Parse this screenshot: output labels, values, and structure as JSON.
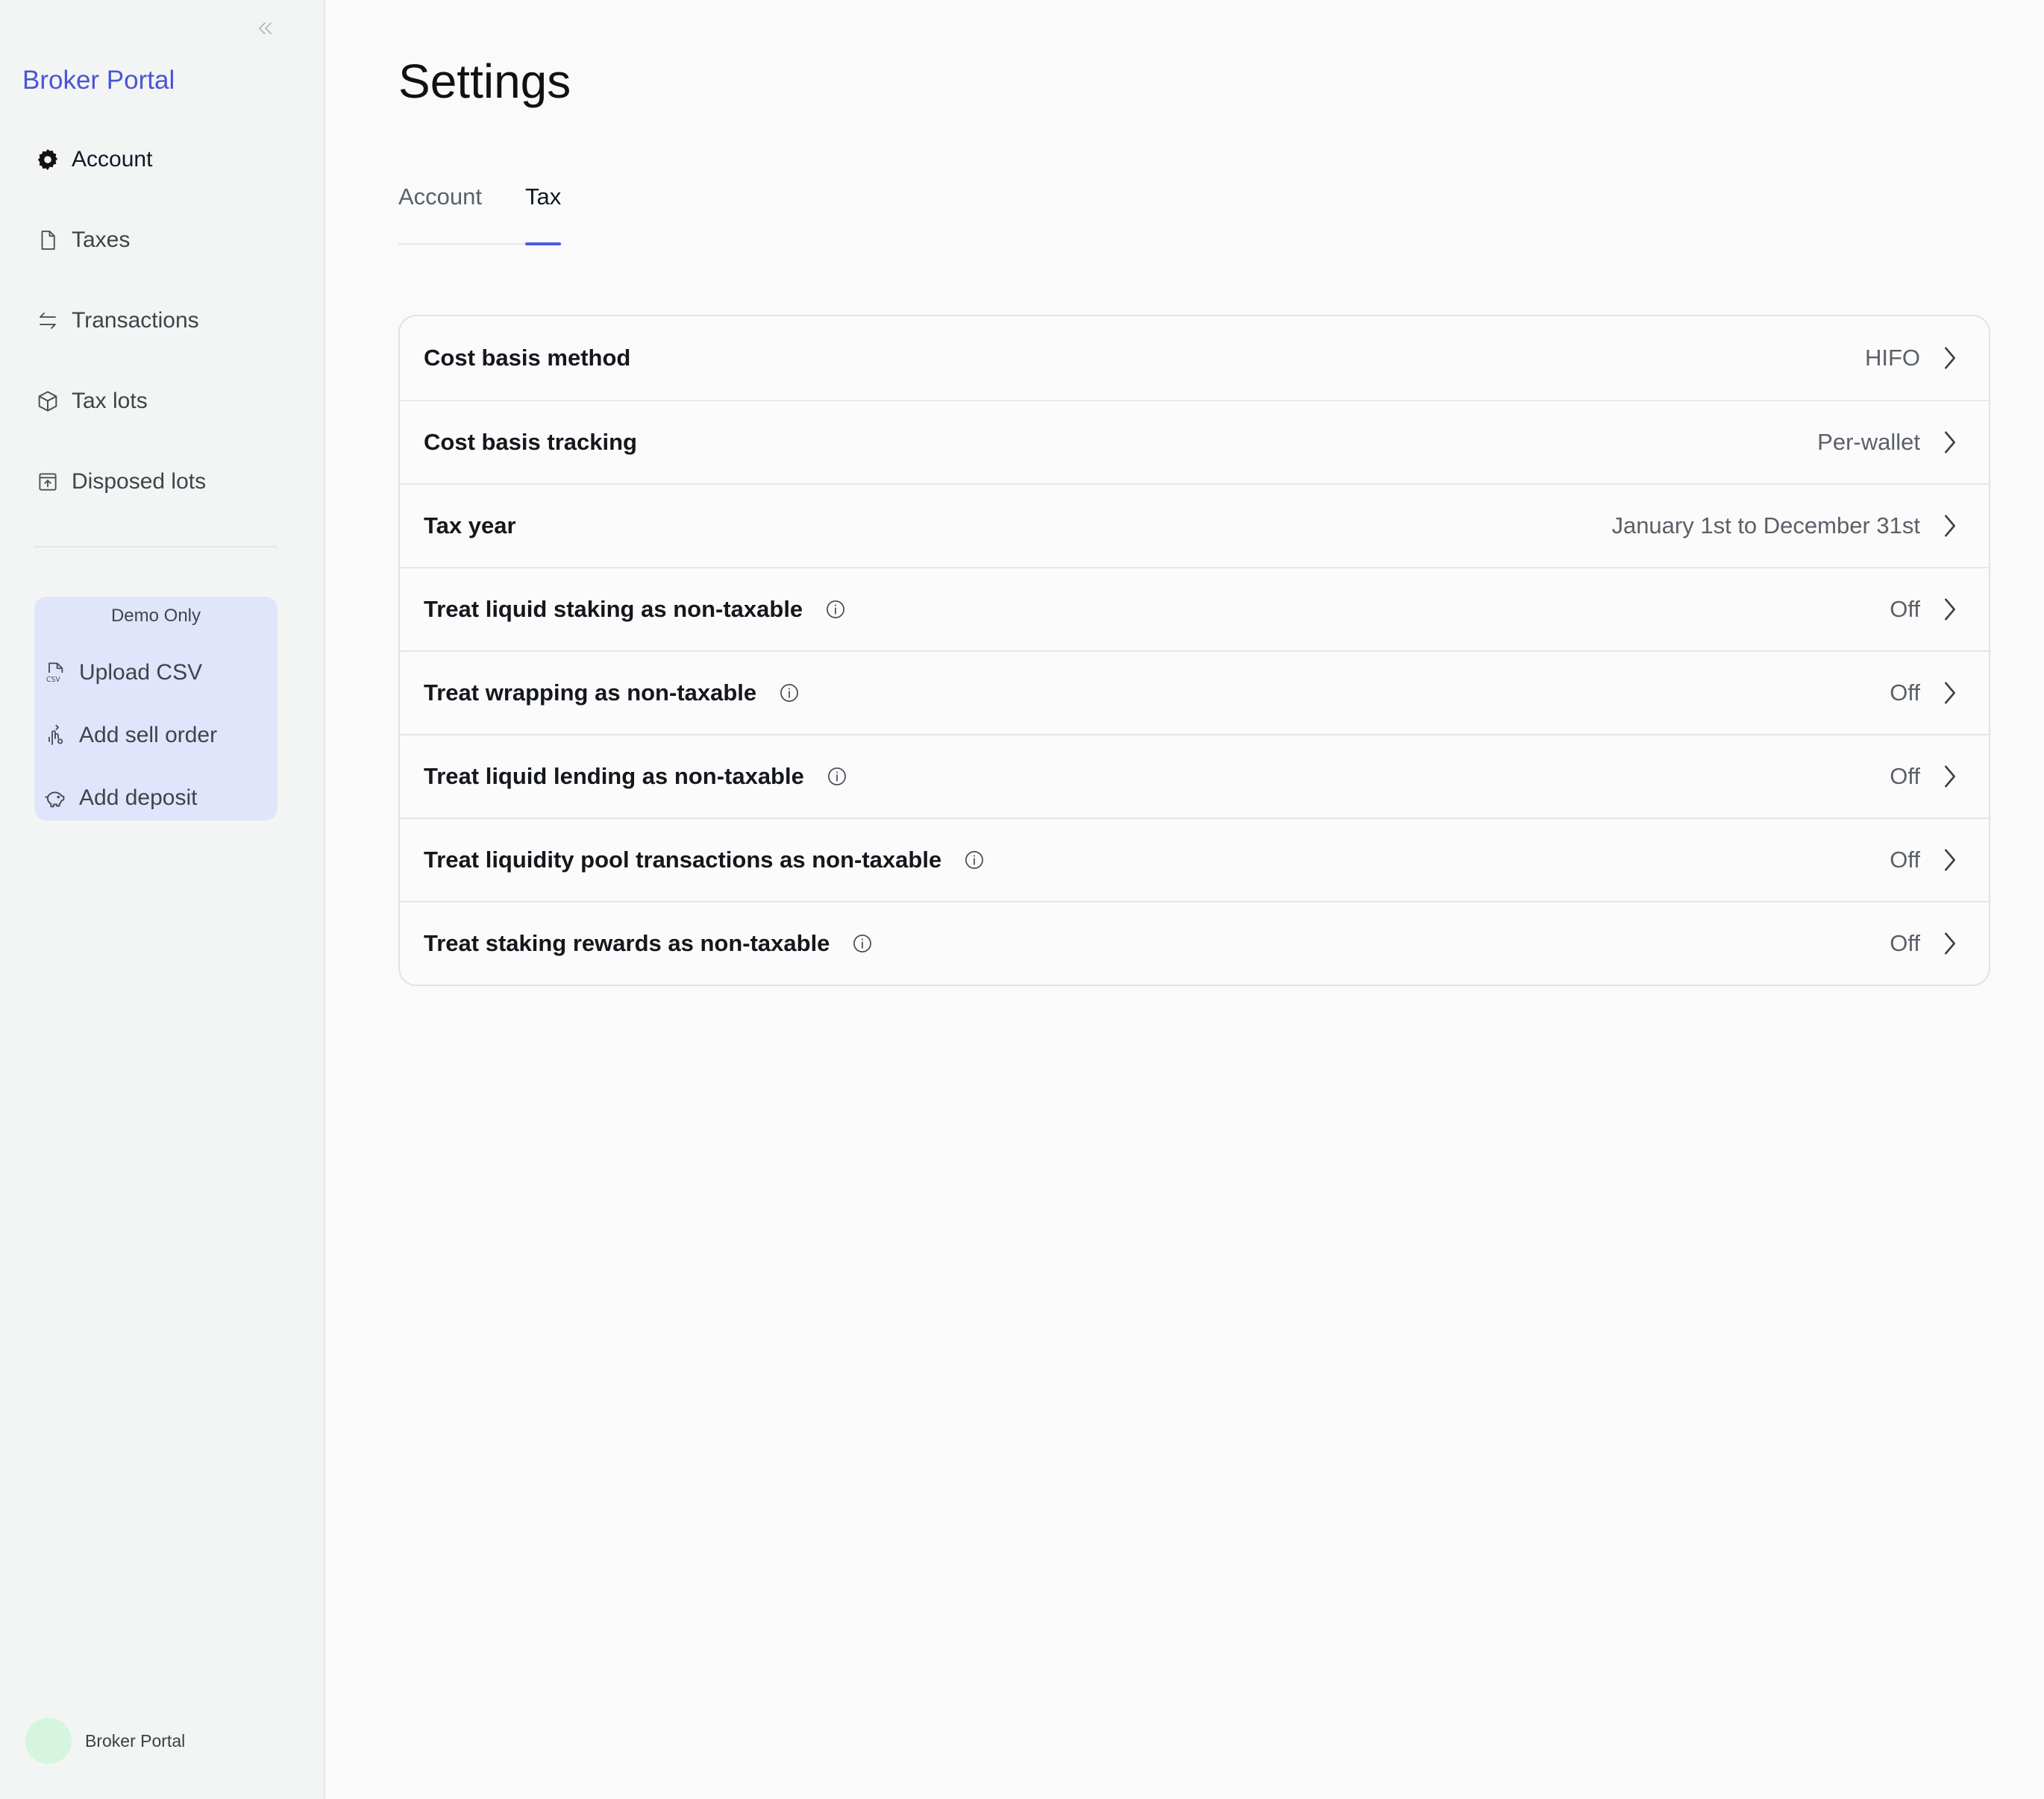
{
  "app": {
    "brand": "Broker Portal"
  },
  "sidebar": {
    "items": [
      {
        "label": "Account",
        "icon": "gear-icon",
        "active": true
      },
      {
        "label": "Taxes",
        "icon": "file-icon"
      },
      {
        "label": "Transactions",
        "icon": "arrows-swap-icon"
      },
      {
        "label": "Tax lots",
        "icon": "cube-icon"
      },
      {
        "label": "Disposed lots",
        "icon": "archive-upload-icon"
      }
    ],
    "demo": {
      "title": "Demo Only",
      "items": [
        {
          "label": "Upload CSV",
          "icon": "csv-file-icon"
        },
        {
          "label": "Add sell order",
          "icon": "hand-coins-icon"
        },
        {
          "label": "Add deposit",
          "icon": "piggy-bank-icon"
        }
      ]
    },
    "user": {
      "name": "Broker Portal"
    }
  },
  "main": {
    "title": "Settings",
    "tabs": [
      {
        "label": "Account"
      },
      {
        "label": "Tax",
        "active": true
      }
    ],
    "settings": [
      {
        "label": "Cost basis method",
        "value": "HIFO",
        "info": false
      },
      {
        "label": "Cost basis tracking",
        "value": "Per-wallet",
        "info": false
      },
      {
        "label": "Tax year",
        "value": "January 1st to December 31st",
        "info": false
      },
      {
        "label": "Treat liquid staking as non-taxable",
        "value": "Off",
        "info": true
      },
      {
        "label": "Treat wrapping as non-taxable",
        "value": "Off",
        "info": true
      },
      {
        "label": "Treat liquid lending as non-taxable",
        "value": "Off",
        "info": true
      },
      {
        "label": "Treat liquidity pool transactions as non-taxable",
        "value": "Off",
        "info": true
      },
      {
        "label": "Treat staking rewards as non-taxable",
        "value": "Off",
        "info": true
      }
    ]
  },
  "colors": {
    "accent": "#4b5be0",
    "brand": "#4b55d6",
    "demo_bg": "#e0e5fb",
    "avatar": "#d6f5de"
  }
}
